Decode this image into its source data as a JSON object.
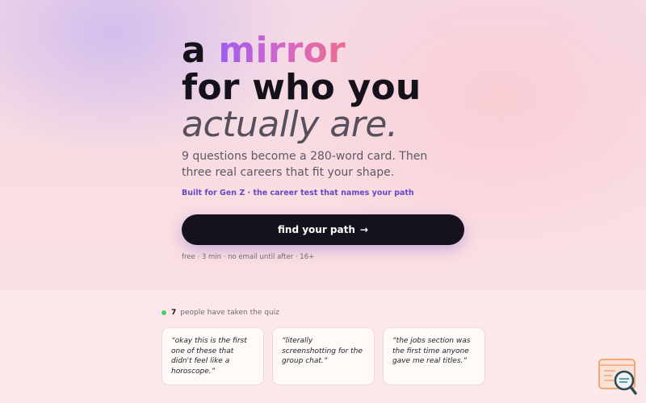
{
  "hero": {
    "headline_prefix": "a ",
    "headline_accent": "mirror",
    "headline_line2": "for who you",
    "headline_line3": "actually are.",
    "subtitle": "9 questions become a 280-word card. Then three real careers that fit your shape.",
    "tagline": "Built for Gen Z · the career test that names your path",
    "cta_label": "find your path",
    "cta_arrow": "→",
    "fine_print": "free · 3 min · no email until after · 16+"
  },
  "social_proof": {
    "count": "7",
    "text": "people have taken the quiz",
    "status_color": "#4ecb6a"
  },
  "testimonials": [
    {
      "quote": "“okay this is the first one of these that didn't feel like a horoscope.”"
    },
    {
      "quote": "“literally screenshotting for the group chat.”"
    },
    {
      "quote": "“the jobs section was the first time anyone gave me real titles.”"
    }
  ],
  "badge": {
    "icon": "search-magnifier-icon"
  },
  "colors": {
    "accent_start": "#9c5cf0",
    "accent_end": "#ea6e8e",
    "cta_background": "#16121d",
    "tagline": "#6747c7"
  }
}
